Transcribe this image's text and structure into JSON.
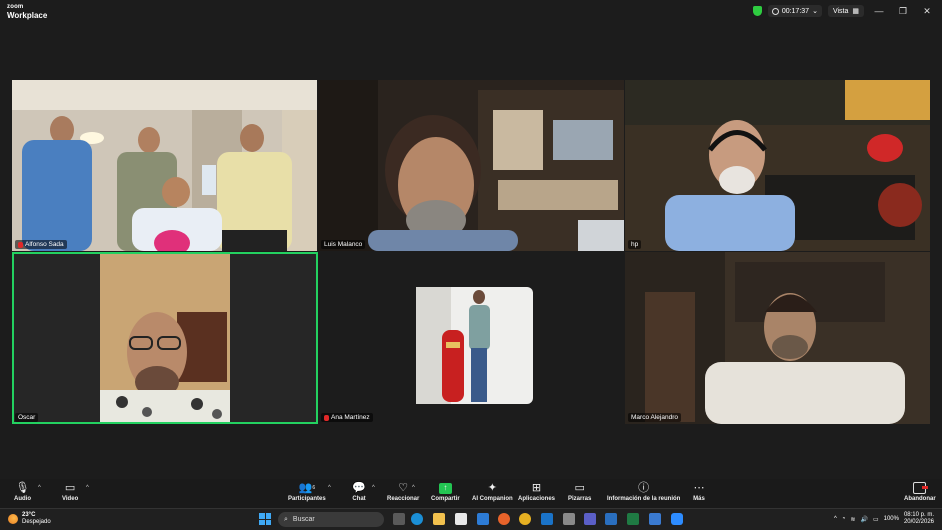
{
  "window": {
    "logo_top": "zoom",
    "logo_bottom": "Workplace",
    "timer": "00:17:37",
    "view_label": "Vista"
  },
  "participants": [
    {
      "name": "Alfonso Sada",
      "muted": true
    },
    {
      "name": "Luis Malanco",
      "muted": false
    },
    {
      "name": "hp",
      "muted": false
    },
    {
      "name": "Oscar",
      "muted": false,
      "active_speaker": true
    },
    {
      "name": "Ana Martínez",
      "muted": true
    },
    {
      "name": "Marco Alejandro",
      "muted": false
    }
  ],
  "toolbar": {
    "audio": "Audio",
    "video": "Video",
    "participants": "Participantes",
    "participants_count": "6",
    "chat": "Chat",
    "react": "Reaccionar",
    "share": "Compartir",
    "ai": "AI Companion",
    "apps": "Aplicaciones",
    "whiteboards": "Pizarras",
    "meeting_info": "Información de la reunión",
    "more": "Más",
    "leave": "Abandonar"
  },
  "taskbar": {
    "temp": "23°C",
    "weather": "Despejado",
    "search_placeholder": "Buscar",
    "battery": "100%",
    "time": "08:10 p. m.",
    "date": "20/02/2026"
  },
  "colors": {
    "active_speaker": "#23d160",
    "share_green": "#23c552",
    "muted_red": "#e02828"
  }
}
